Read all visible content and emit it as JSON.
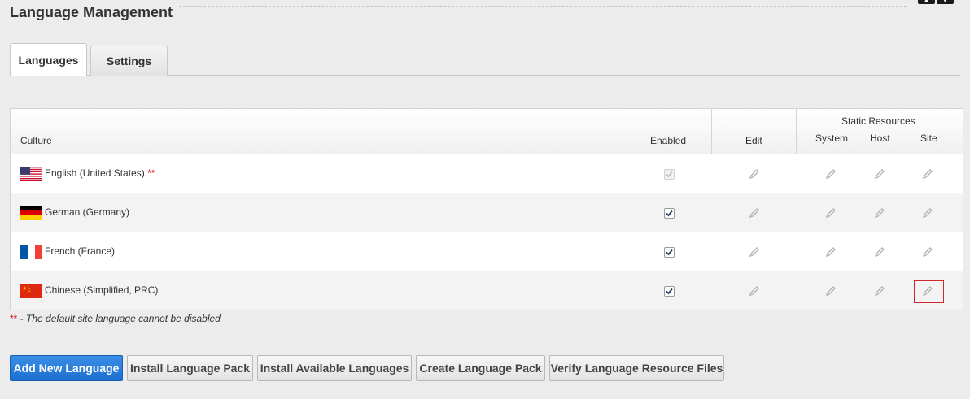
{
  "page": {
    "title": "Language Management"
  },
  "tabs": [
    {
      "label": "Languages",
      "active": true
    },
    {
      "label": "Settings",
      "active": false
    }
  ],
  "grid": {
    "headers": {
      "culture": "Culture",
      "enabled": "Enabled",
      "edit": "Edit",
      "static_resources": "Static Resources",
      "system": "System",
      "host": "Host",
      "site": "Site"
    },
    "rows": [
      {
        "culture": "English (United States)",
        "required_mark": "**",
        "flag": "us-flag-icon",
        "enabled": true,
        "enabled_disabled": true
      },
      {
        "culture": "German (Germany)",
        "required_mark": "",
        "flag": "de-flag-icon",
        "enabled": true,
        "enabled_disabled": false
      },
      {
        "culture": "French (France)",
        "required_mark": "",
        "flag": "fr-flag-icon",
        "enabled": true,
        "enabled_disabled": false
      },
      {
        "culture": "Chinese (Simplified, PRC)",
        "required_mark": "",
        "flag": "cn-flag-icon",
        "enabled": true,
        "enabled_disabled": false
      }
    ]
  },
  "note": {
    "mark": "**",
    "text": " - The default site language cannot be disabled"
  },
  "buttons": {
    "add": "Add New Language",
    "install_pack": "Install Language Pack",
    "install_available": "Install Available Languages",
    "create_pack": "Create Language Pack",
    "verify": "Verify Language Resource Files"
  },
  "colors": {
    "primary": "#1d6fd0",
    "required": "#dd0000",
    "focus_border": "#cc2a2a"
  }
}
